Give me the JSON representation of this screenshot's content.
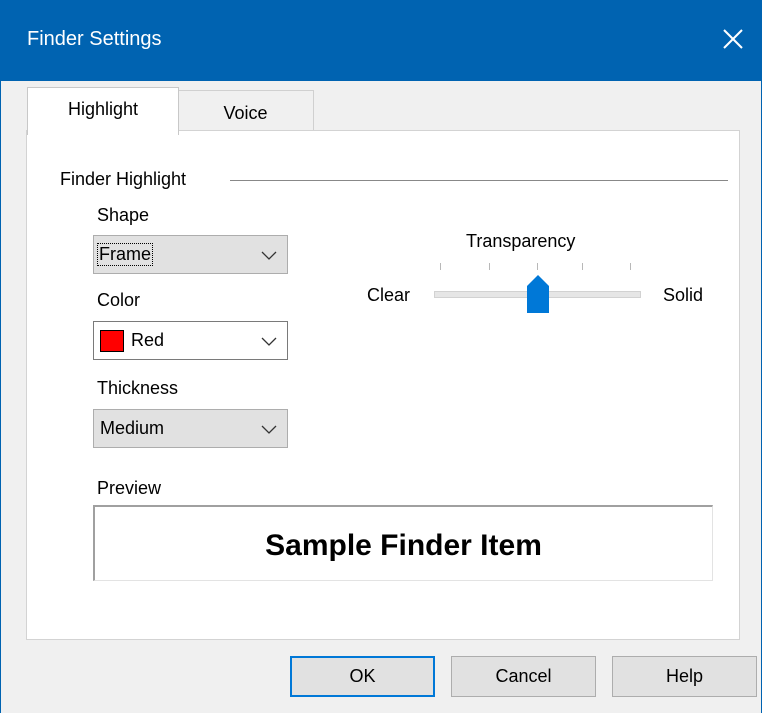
{
  "window": {
    "title": "Finder Settings",
    "close_icon": "close-icon"
  },
  "tabs": [
    {
      "label": "Highlight",
      "selected": true
    },
    {
      "label": "Voice",
      "selected": false
    }
  ],
  "group": {
    "title": "Finder Highlight",
    "shape": {
      "label": "Shape",
      "value": "Frame"
    },
    "color": {
      "label": "Color",
      "value": "Red",
      "swatch": "#ff0000"
    },
    "thickness": {
      "label": "Thickness",
      "value": "Medium"
    },
    "transparency": {
      "label": "Transparency",
      "min_label": "Clear",
      "max_label": "Solid",
      "level": 0.5
    },
    "preview": {
      "label": "Preview",
      "sample": "Sample Finder Item"
    }
  },
  "buttons": {
    "ok": "OK",
    "cancel": "Cancel",
    "help": "Help"
  },
  "colors": {
    "titlebar": "#0063b1",
    "accent": "#0078d7"
  }
}
